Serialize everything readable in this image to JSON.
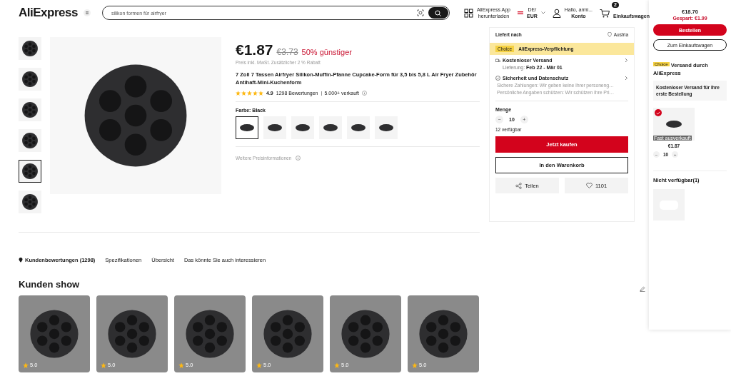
{
  "header": {
    "logo": "AliExpress",
    "search_value": "silikon formen für airfryer",
    "app_line1": "AliExpress App",
    "app_line2": "herunterladen",
    "locale_line1": "DE/",
    "locale_line2": "EUR",
    "account_line1": "Hallo, armi...",
    "account_line2": "Konto",
    "cart_count": "2",
    "cart_label": "Einkaufswagen"
  },
  "thumbs": [
    {
      "selected": false
    },
    {
      "selected": false
    },
    {
      "selected": false
    },
    {
      "selected": false
    },
    {
      "selected": true
    },
    {
      "selected": false
    }
  ],
  "product": {
    "price": "€1.87",
    "old_price": "€3.73",
    "discount": "50% günstiger",
    "tax_note": "Preis inkl. MwSt. Zusätzlicher 2 % Rabatt",
    "title": "7 Zoll 7 Tassen Airfryer Silikon-Muffin-Pfanne Cupcake-Form für 3,5 bis 5,8 L Air Fryer Zubehör Antihaft-Mini-Kuchenform",
    "stars": 5,
    "rating": "4.9",
    "reviews": "1298 Bewertungen",
    "sold": "5.000+ verkauft",
    "color_label": "Farbe: Black",
    "more_price_info": "Weitere Preisinformationen"
  },
  "variants": [
    {
      "selected": true
    },
    {
      "selected": false
    },
    {
      "selected": false
    },
    {
      "selected": false
    },
    {
      "selected": false
    },
    {
      "selected": false
    }
  ],
  "buybox": {
    "ship_to_label": "Liefert nach",
    "ship_to": "Austria",
    "choice_badge": "Choice",
    "commitment": "AliExpress-Verpflichtung",
    "shipping_title": "Kostenloser Versand",
    "delivery_label": "Lieferung:",
    "delivery_dates": "Feb 22 - Mär 01",
    "security_title": "Sicherheit und Datenschutz",
    "security_lines": [
      "Sichere Zahlungen: Wir geben keine Ihrer personeng…",
      "Persönliche Angaben schützen: Wir schützen Ihre Pri…"
    ],
    "quantity_label": "Menge",
    "minus": "−",
    "quantity": "10",
    "plus": "+",
    "stock": "12 verfügbar",
    "buy_now": "Jetzt kaufen",
    "add_to_cart": "In den Warenkorb",
    "share": "Teilen",
    "wishlist_count": "1101"
  },
  "tabs": [
    {
      "label": "Kundenbewertungen (1298)",
      "selected": true
    },
    {
      "label": "Spezifikationen",
      "selected": false
    },
    {
      "label": "Übersicht",
      "selected": false
    },
    {
      "label": "Das könnte Sie auch interessieren",
      "selected": false
    }
  ],
  "reviews_title": "Kunden show",
  "photos": [
    {
      "rating": "5.0"
    },
    {
      "rating": "5.0"
    },
    {
      "rating": "5.0"
    },
    {
      "rating": "5.0"
    },
    {
      "rating": "5.0"
    },
    {
      "rating": "5.0"
    }
  ],
  "cart": {
    "total": "€18.70",
    "saved": "Gespart: €1.99",
    "order": "Bestellen",
    "to_cart": "Zum Einkaufswagen",
    "choice_badge": "Choice",
    "shipping_title": "Versand durch AliExpress",
    "promo": "Kostenloser Versand für Ihre erste Bestellung",
    "items": [
      {
        "checked": true,
        "badge": "Fast ausverkauft",
        "price": "€1.87",
        "minus": "−",
        "quantity": "10",
        "plus": "+"
      }
    ],
    "unavailable_title": "Nicht verfügbar(1)"
  }
}
